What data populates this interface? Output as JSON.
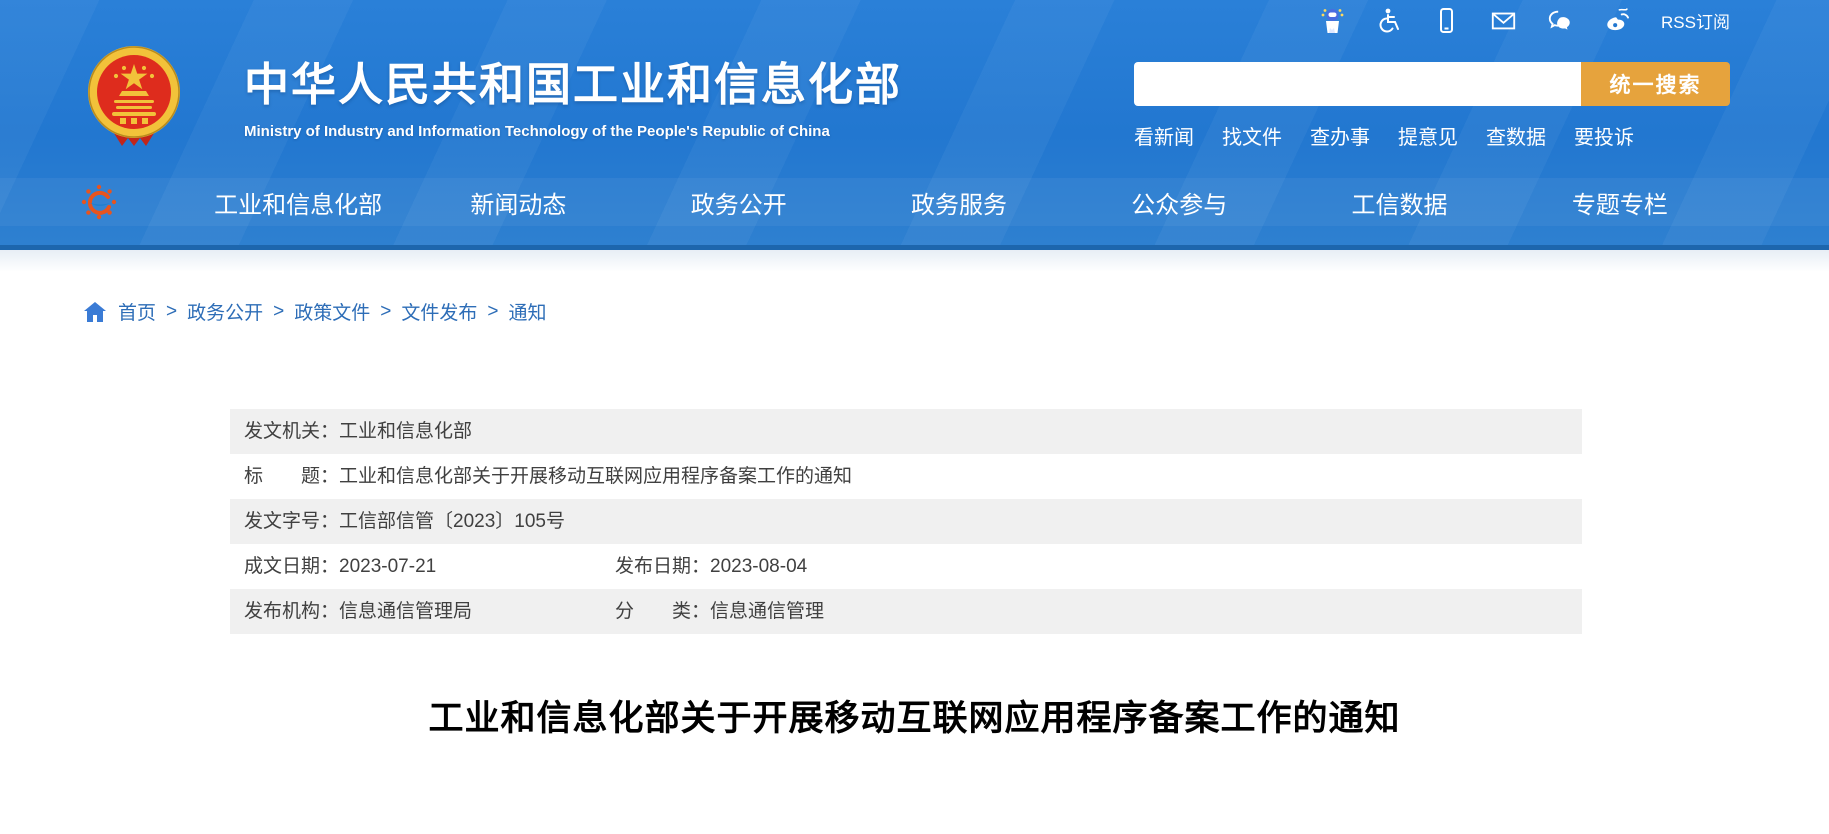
{
  "topbar": {
    "icons": [
      "assistant-robot-icon",
      "accessibility-icon",
      "mobile-icon",
      "email-icon",
      "wechat-icon",
      "weibo-icon"
    ],
    "rss_label": "RSS订阅"
  },
  "header": {
    "site_title": "中华人民共和国工业和信息化部",
    "site_subtitle": "Ministry of Industry and Information Technology of the People's Republic of China",
    "search": {
      "value": "",
      "placeholder": "",
      "button_label": "统一搜索"
    },
    "quick_links": [
      "看新闻",
      "找文件",
      "查办事",
      "提意见",
      "查数据",
      "要投诉"
    ]
  },
  "nav": {
    "items": [
      "工业和信息化部",
      "新闻动态",
      "政务公开",
      "政务服务",
      "公众参与",
      "工信数据",
      "专题专栏"
    ]
  },
  "breadcrumb": {
    "separator": ">",
    "items": [
      "首页",
      "政务公开",
      "政策文件",
      "文件发布",
      "通知"
    ]
  },
  "doc_info": {
    "rows": [
      {
        "label": "发文机关：",
        "value": "工业和信息化部",
        "label2": "",
        "value2": ""
      },
      {
        "label": "标　　题：",
        "value": "工业和信息化部关于开展移动互联网应用程序备案工作的通知",
        "label2": "",
        "value2": ""
      },
      {
        "label": "发文字号：",
        "value": "工信部信管〔2023〕105号",
        "label2": "",
        "value2": ""
      },
      {
        "label": "成文日期：",
        "value": "2023-07-21",
        "label2": "发布日期：",
        "value2": "2023-08-04"
      },
      {
        "label": "发布机构：",
        "value": "信息通信管理局",
        "label2": "分　　类：",
        "value2": "信息通信管理"
      }
    ]
  },
  "article": {
    "title": "工业和信息化部关于开展移动互联网应用程序备案工作的通知"
  },
  "colors": {
    "header_blue": "#2277d0",
    "header_bottom_strip": "#1d66ad",
    "search_button_orange": "#e6a33d",
    "breadcrumb_blue": "#2d6db7",
    "table_row_gray": "#f0f0f0",
    "body_text": "#404040",
    "emblem_red": "#de2c1d",
    "emblem_gold": "#f2c23a"
  }
}
